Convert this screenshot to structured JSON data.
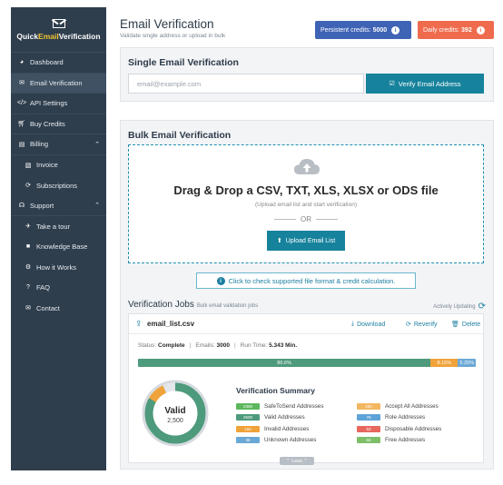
{
  "brand": {
    "name_a": "Quick",
    "name_b": "Email",
    "name_c": "Verification"
  },
  "sidebar": {
    "items": [
      {
        "label": "Dashboard",
        "icon": "palette-icon"
      },
      {
        "label": "Email Verification",
        "icon": "envelope-icon"
      },
      {
        "label": "API Settings",
        "icon": "code-icon"
      },
      {
        "label": "Buy Credits",
        "icon": "cart-icon"
      },
      {
        "label": "Billing",
        "icon": "document-icon"
      },
      {
        "label": "Invoice",
        "icon": "invoice-icon"
      },
      {
        "label": "Subscriptions",
        "icon": "refresh-icon"
      },
      {
        "label": "Support",
        "icon": "headset-icon"
      },
      {
        "label": "Take a tour",
        "icon": "plane-icon"
      },
      {
        "label": "Knowledge Base",
        "icon": "book-icon"
      },
      {
        "label": "How it Works",
        "icon": "gear-icon"
      },
      {
        "label": "FAQ",
        "icon": "question-icon"
      },
      {
        "label": "Contact",
        "icon": "mail-icon"
      }
    ]
  },
  "header": {
    "title": "Email Verification",
    "subtitle": "Validate single address or upload in bulk",
    "persistent_label": "Persistent credits:",
    "persistent_value": "5000",
    "daily_label": "Daily credits:",
    "daily_value": "392"
  },
  "single": {
    "heading": "Single Email Verification",
    "placeholder": "email@example.com",
    "button": "Verify Email Address"
  },
  "bulk": {
    "heading": "Bulk Email Verification",
    "drop_title": "Drag & Drop a CSV, TXT, XLS, XLSX or ODS file",
    "drop_sub": "(Upload email list and start verification)",
    "or": "OR",
    "upload_button": "Upload Email List",
    "check_link": "Click to check supported file format & credit calculation."
  },
  "jobs": {
    "heading": "Verification Jobs",
    "subheading": "Bulk email validation jobs",
    "auto_label": "Actively Updating",
    "file_name": "email_list.csv",
    "download": "Download",
    "reverify": "Reverify",
    "delete": "Delete",
    "status_label": "Status:",
    "status_value": "Complete",
    "emails_label": "Emails:",
    "emails_value": "3000",
    "runtime_label": "Run Time:",
    "runtime_value": "5.343 Min.",
    "progress": [
      {
        "label": "86.6%",
        "value": 86.6,
        "color": "#4e9a7c"
      },
      {
        "label": "8.15%",
        "value": 8.15,
        "color": "#f0a33a"
      },
      {
        "label": "5.25%",
        "value": 5.25,
        "color": "#6aa8d6"
      }
    ],
    "donut_label": "Valid",
    "donut_value": "2,500",
    "donut_fraction": 0.8333,
    "summary_title": "Verification Summary",
    "summary_left": [
      {
        "count": "2300",
        "label": "SafeToSend Addresses",
        "color": "#5cb85c"
      },
      {
        "count": "2500",
        "label": "Valid Addresses",
        "color": "#4e9a7c"
      },
      {
        "count": "164",
        "label": "Invalid Addresses",
        "color": "#f0a33a"
      },
      {
        "count": "36",
        "label": "Unknown Addresses",
        "color": "#6aa8d6"
      }
    ],
    "summary_right": [
      {
        "count": "200",
        "label": "Accept All Addresses",
        "color": "#f3b760"
      },
      {
        "count": "76",
        "label": "Role Addresses",
        "color": "#5fa4d8"
      },
      {
        "count": "53",
        "label": "Disposable Addresses",
        "color": "#e8685e"
      },
      {
        "count": "84",
        "label": "Free Addresses",
        "color": "#7fbf6a"
      }
    ],
    "less": "Less"
  }
}
